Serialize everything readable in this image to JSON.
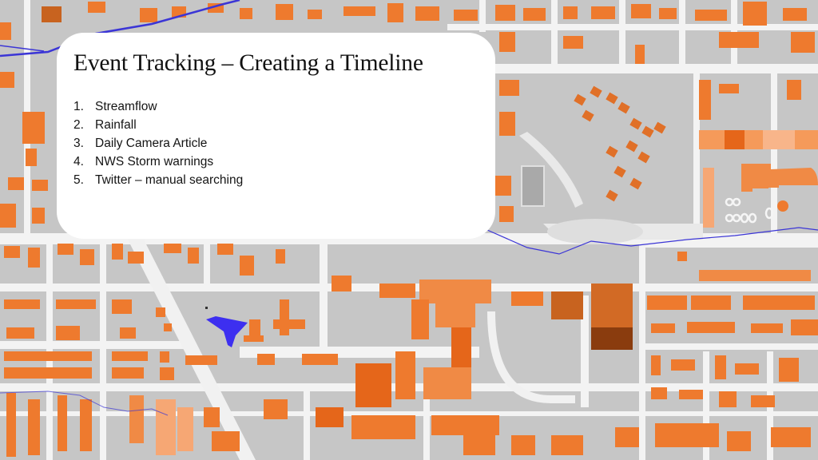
{
  "slide": {
    "title": "Event Tracking – Creating a Timeline",
    "items": [
      {
        "number": "1.",
        "label": "Streamflow"
      },
      {
        "number": "2.",
        "label": "Rainfall"
      },
      {
        "number": "3.",
        "label": "Daily Camera Article"
      },
      {
        "number": "4.",
        "label": "NWS Storm warnings"
      },
      {
        "number": "5.",
        "label": "Twitter – manual searching"
      }
    ]
  },
  "background": {
    "description": "Aerial map with building footprints highlighted in orange, stream lines in blue and a flooded area in blue",
    "colors": {
      "ground": "#c9c9c9",
      "road": "#f4f4f4",
      "building": "#ee7a2e",
      "building_dark": "#b85818",
      "building_light": "#f6a774",
      "stream": "#3b35d6",
      "flood_area": "#3d2ff0"
    }
  }
}
